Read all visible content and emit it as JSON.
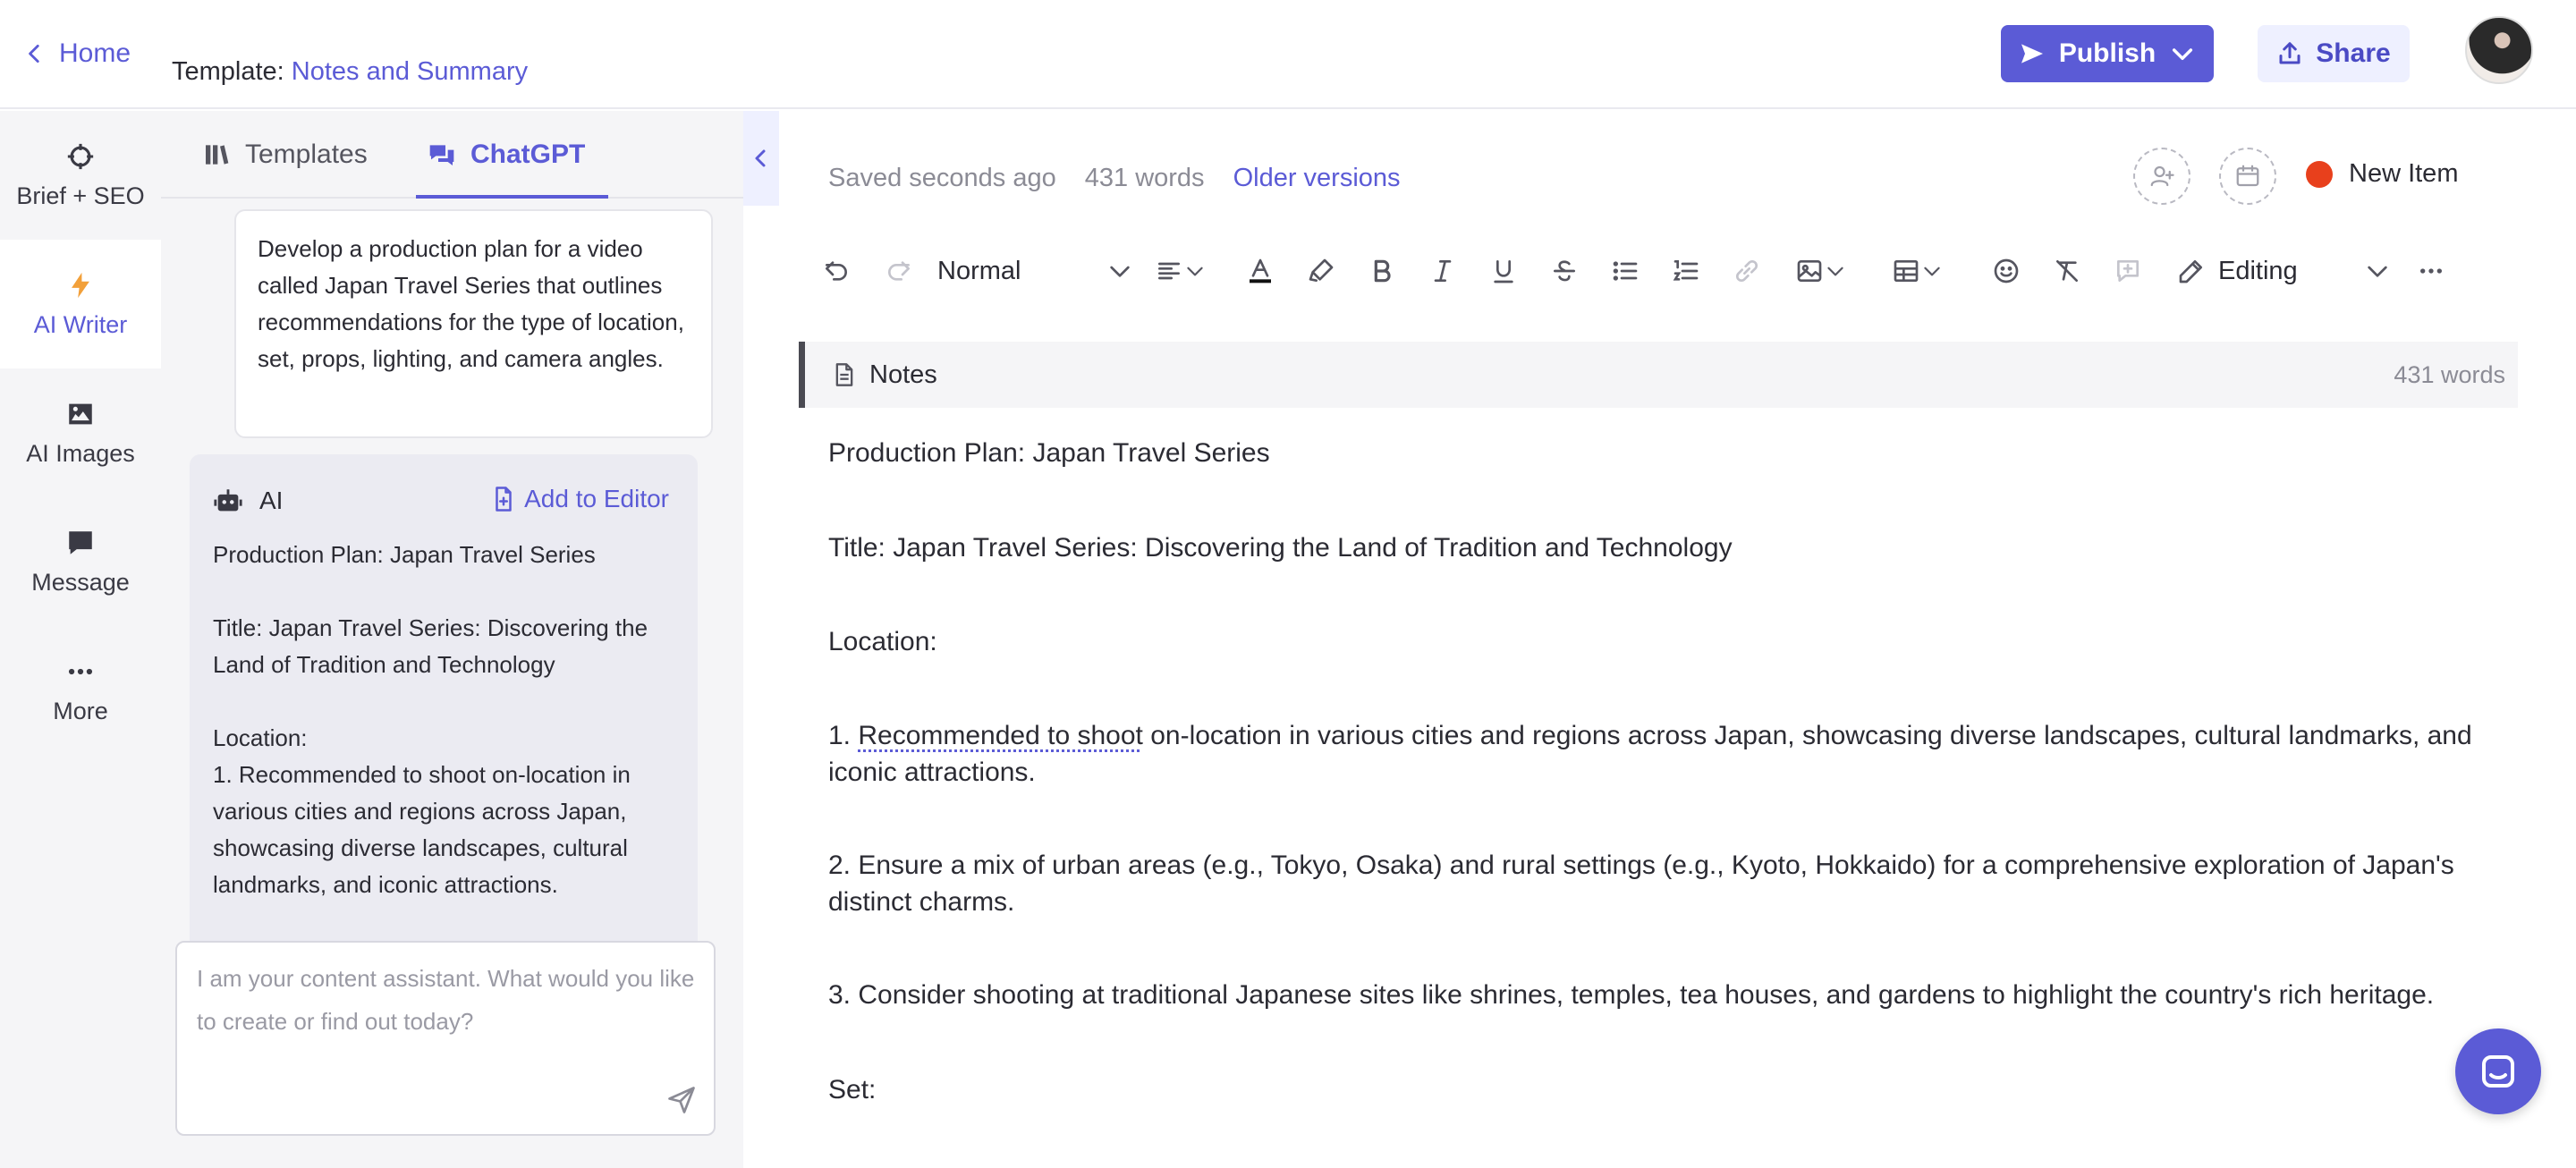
{
  "header": {
    "home_label": "Home",
    "template_prefix": "Template:",
    "template_name": "Notes and Summary",
    "publish_label": "Publish",
    "share_label": "Share"
  },
  "nav": {
    "items": [
      {
        "label": "Brief + SEO",
        "icon": "crosshair-icon"
      },
      {
        "label": "AI Writer",
        "icon": "bolt-icon"
      },
      {
        "label": "AI Images",
        "icon": "image-icon"
      },
      {
        "label": "Message",
        "icon": "message-icon"
      },
      {
        "label": "More",
        "icon": "more-icon"
      }
    ],
    "active": "AI Writer"
  },
  "panel": {
    "tabs": [
      {
        "label": "Templates",
        "icon": "books-icon"
      },
      {
        "label": "ChatGPT",
        "icon": "chat-bubbles-icon"
      }
    ],
    "active_tab": "ChatGPT",
    "prompt_text": "Develop a production plan for a video called Japan Travel Series that outlines recommendations for the type of location, set, props, lighting, and camera angles.",
    "ai_label": "AI",
    "add_to_editor_label": "Add to Editor",
    "ai_lines": [
      "Production Plan: Japan Travel Series",
      "",
      "Title: Japan Travel Series: Discovering the Land of Tradition and Technology",
      "",
      "Location:",
      "1. Recommended to shoot on-location in various cities and regions across Japan, showcasing diverse landscapes, cultural landmarks, and iconic attractions."
    ],
    "chat_placeholder": "I am your content assistant. What would you like to create or find out today?"
  },
  "editor": {
    "saved_status": "Saved seconds ago",
    "word_count": "431 words",
    "older_versions_label": "Older versions",
    "new_item_label": "New Item",
    "status_color": "#e8401c",
    "accent_color": "#5b5bd6",
    "toolbar": {
      "style_label": "Normal",
      "mode_label": "Editing"
    },
    "notes_title": "Notes",
    "notes_word_count": "431 words",
    "doc": {
      "p1": "Production Plan: Japan Travel Series",
      "p2": "Title: Japan Travel Series: Discovering the Land of Tradition and Technology",
      "p3": "Location:",
      "p4_underlined": "Recommended to shoot",
      "p4_prefix": "1. ",
      "p4_rest": " on-location in various cities and regions across Japan, showcasing diverse landscapes, cultural landmarks, and iconic attractions.",
      "p5": "2. Ensure a mix of urban areas (e.g., Tokyo, Osaka) and rural settings (e.g., Kyoto, Hokkaido) for a comprehensive exploration of Japan's distinct charms.",
      "p6": "3. Consider shooting at traditional Japanese sites like shrines, temples, tea houses, and gardens to highlight the country's rich heritage.",
      "p7": "Set:"
    }
  }
}
